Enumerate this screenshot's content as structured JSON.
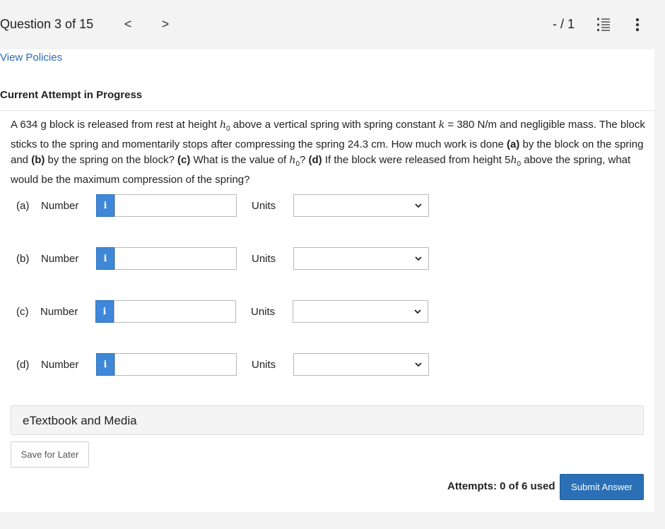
{
  "header": {
    "question_counter": "Question 3 of 15",
    "prev_glyph": "<",
    "next_glyph": ">",
    "score": "- / 1"
  },
  "policies_link": "View Policies",
  "attempt_heading": "Current Attempt in Progress",
  "question": {
    "t1": "A 634 g block is released from rest at height ",
    "h_sym": "h",
    "h_sub": "0",
    "t2": " above a vertical spring with spring constant ",
    "k_sym": "k",
    "t3": " = 380 N/m and negligible mass. The block sticks to the spring and momentarily stops after compressing the spring 24.3 cm. How much work is done ",
    "a": "(a)",
    "t4": " by the block on the spring and ",
    "b": "(b)",
    "t5": " by the spring on the block? ",
    "c": "(c)",
    "t6": " What is the value of ",
    "t7": "? ",
    "d": "(d)",
    "t8": " If the block were released from height 5",
    "t9": " above the spring, what would be the maximum compression of the spring?"
  },
  "answers": [
    {
      "part": "(a)",
      "number_label": "Number",
      "info": "i",
      "value": "",
      "units_label": "Units",
      "units_value": ""
    },
    {
      "part": "(b)",
      "number_label": "Number",
      "info": "i",
      "value": "",
      "units_label": "Units",
      "units_value": ""
    },
    {
      "part": "(c)",
      "number_label": "Number",
      "info": "i",
      "value": "",
      "units_label": "Units",
      "units_value": ""
    },
    {
      "part": "(d)",
      "number_label": "Number",
      "info": "i",
      "value": "",
      "units_label": "Units",
      "units_value": ""
    }
  ],
  "etextbook_label": "eTextbook and Media",
  "save_label": "Save for Later",
  "attempts_text": "Attempts: 0 of 6 used",
  "submit_label": "Submit Answer",
  "colors": {
    "link": "#2a6cb3",
    "info_button": "#3f87d8",
    "submit_button": "#2b70b6"
  },
  "icons": {
    "prev": "chevron-left-icon",
    "next": "chevron-right-icon",
    "list": "numbered-list-icon",
    "more": "more-vertical-icon",
    "select": "chevron-down-icon"
  }
}
